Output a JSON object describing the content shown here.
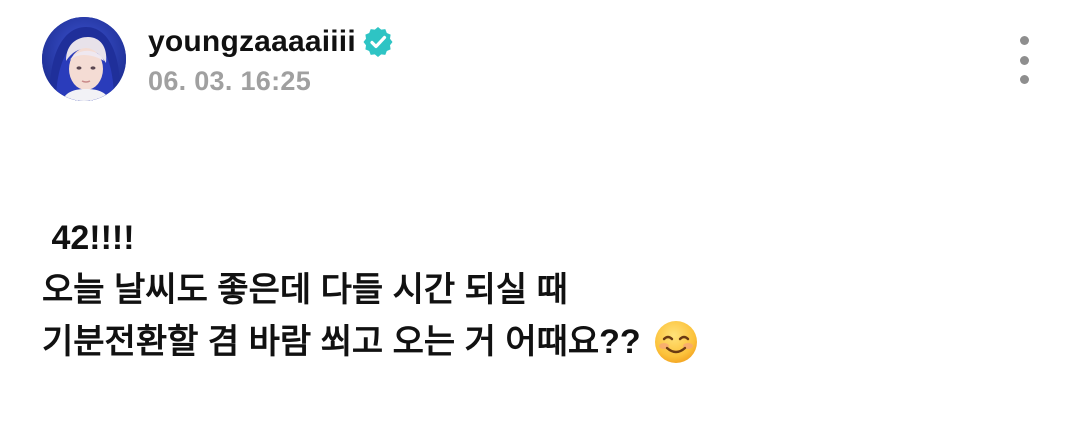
{
  "post": {
    "author": {
      "username": "youngzaaaaiiii",
      "verified": true,
      "avatar_icon": "avatar-photo"
    },
    "timestamp": "06. 03. 16:25",
    "menu_icon": "more-vertical-icon",
    "body": {
      "lines": [
        " 42!!!!",
        "오늘 날씨도 좋은데 다들 시간 되실 때",
        "기분전환할 겸 바람 쐬고 오는 거 어때요??"
      ],
      "trailing_emoji": "smiling-face-icon"
    }
  },
  "colors": {
    "verified_badge": "#2ec4c4",
    "text_primary": "#111111",
    "text_secondary": "#a0a0a0",
    "menu_dots": "#8e8e8e"
  }
}
